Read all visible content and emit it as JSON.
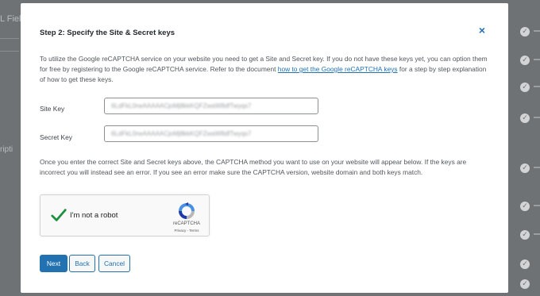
{
  "background": {
    "left_text_1": "L Fiel",
    "left_text_2": "ripti"
  },
  "modal": {
    "title": "Step 2: Specify the Site & Secret keys",
    "close_symbol": "×",
    "intro_text": "To utilize the Google reCAPTCHA service on your website you need to get a Site and Secret key. If you do not have these keys yet, you can option them for free by registering to the Google reCAPTCHA service. Refer to the document ",
    "intro_link": "how to get the Google reCAPTCHA keys",
    "intro_text_after": " for a step by step explanation of how to get these keys.",
    "site_key_label": "Site Key",
    "site_key_value": "6LdFkL0rwAAAAACjoMj8kkKQFZwaW8dfTwyqs7",
    "secret_key_label": "Secret Key",
    "secret_key_value": "6LdFkL0rwAAAAACjoMj8kkKQFZwaW8dfTwyqs7",
    "note_text": "Once you enter the correct Site and Secret keys above, the CAPTCHA method you want to use on your website will appear below. If the keys are incorrect you will instead see an error. If you see an error make sure the CAPTCHA version, website domain and both keys match.",
    "recaptcha": {
      "label": "I'm not a robot",
      "brand": "reCAPTCHA",
      "links": "Privacy - Terms",
      "checked": true
    },
    "buttons": {
      "next": "Next",
      "back": "Back",
      "cancel": "Cancel"
    }
  },
  "colors": {
    "accent": "#2271b1",
    "check_green": "#1e8e3e",
    "overlay": "#6f7275"
  },
  "icons": {
    "close": "close-icon",
    "check": "checkmark-icon",
    "recaptcha_logo": "recaptcha-logo-icon"
  }
}
